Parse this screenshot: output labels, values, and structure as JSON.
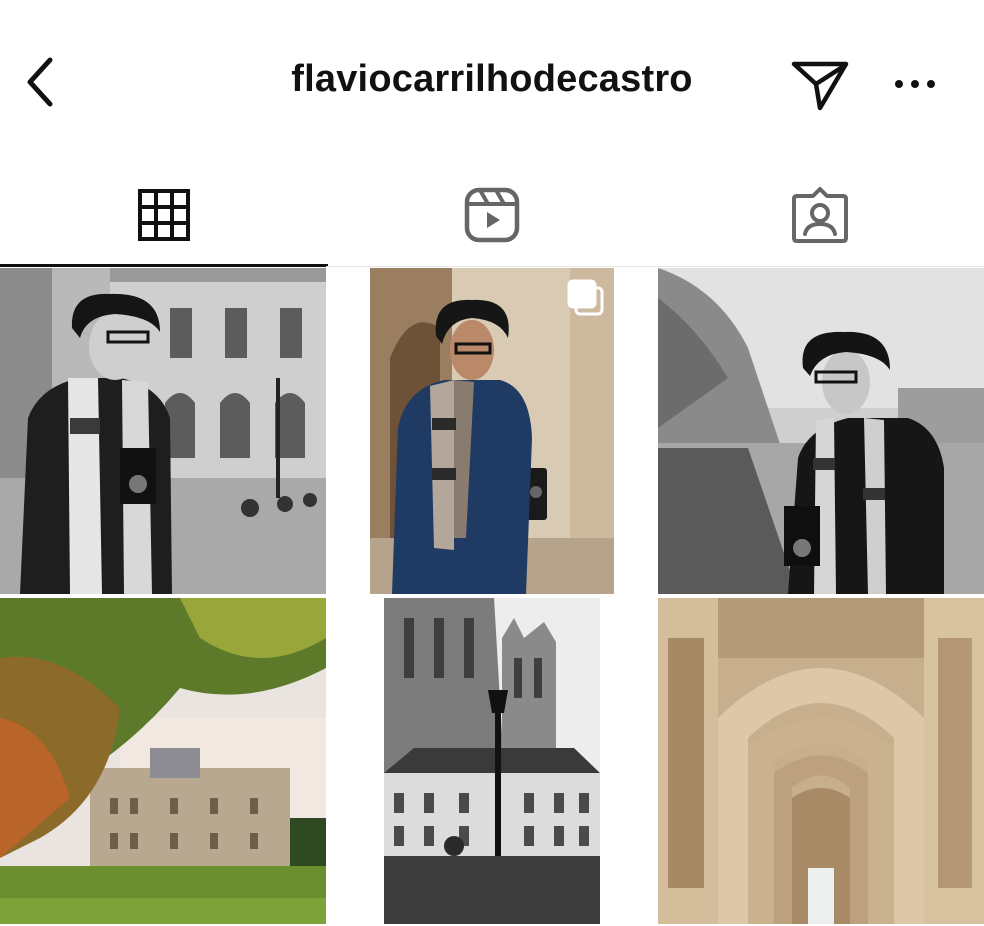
{
  "header": {
    "username": "flaviocarrilhodecastro",
    "back_icon": "chevron-left-icon",
    "send_icon": "paper-plane-icon",
    "more_icon": "more-horizontal-icon"
  },
  "tabs": [
    {
      "name": "posts",
      "icon": "grid-icon",
      "active": true
    },
    {
      "name": "reels",
      "icon": "reels-icon",
      "active": false
    },
    {
      "name": "tagged",
      "icon": "tagged-person-icon",
      "active": false
    }
  ],
  "posts": [
    {
      "description_id": "bw-man-scarf-louvre-courtyard",
      "multi": false
    },
    {
      "description_id": "color-man-navy-coat-arcade",
      "multi": true
    },
    {
      "description_id": "bw-man-scarf-camera-seine",
      "multi": false
    },
    {
      "description_id": "autumn-tree-chateau-lawn",
      "multi": false
    },
    {
      "description_id": "bw-cathedral-streetlamp",
      "multi": false
    },
    {
      "description_id": "sepia-arcade-corridor",
      "multi": false
    }
  ],
  "colors": {
    "text": "#111111",
    "icon_gray": "#666666",
    "divider": "#e6e6e6"
  }
}
